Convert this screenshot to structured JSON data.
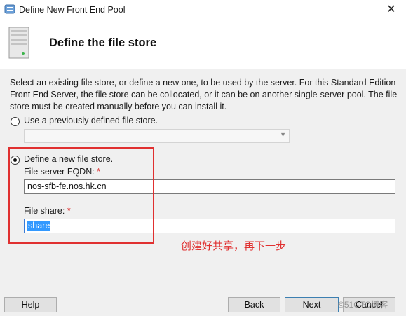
{
  "window": {
    "title": "Define New Front End Pool",
    "close_glyph": "✕",
    "app_icon": "pool-app-icon"
  },
  "header": {
    "title": "Define the file store",
    "icon": "server-icon"
  },
  "description": "Select an existing file store, or define a new one, to be used by the server. For this Standard Edition Front End Server, the file store can be collocated, or it can be on another single-server pool. The file store must be created manually before you can install it.",
  "options": {
    "existing": {
      "label": "Use a previously defined file store.",
      "selected": false
    },
    "new": {
      "label": "Define a new file store.",
      "selected": true
    }
  },
  "existing_select": {
    "value": "",
    "enabled": false
  },
  "fields": {
    "fqdn": {
      "label": "File server FQDN:",
      "required_mark": "*",
      "value": "nos-sfb-fe.nos.hk.cn"
    },
    "share": {
      "label": "File share:",
      "required_mark": "*",
      "value": "share"
    }
  },
  "annotation": "创建好共享，再下一步",
  "buttons": {
    "help": "Help",
    "back": "Back",
    "next": "Next",
    "cancel": "Cancel"
  },
  "watermark": "©51CTO博客",
  "colors": {
    "annotation": "#e03030",
    "selection": "#3399ff",
    "focus": "#3a7bd5"
  }
}
